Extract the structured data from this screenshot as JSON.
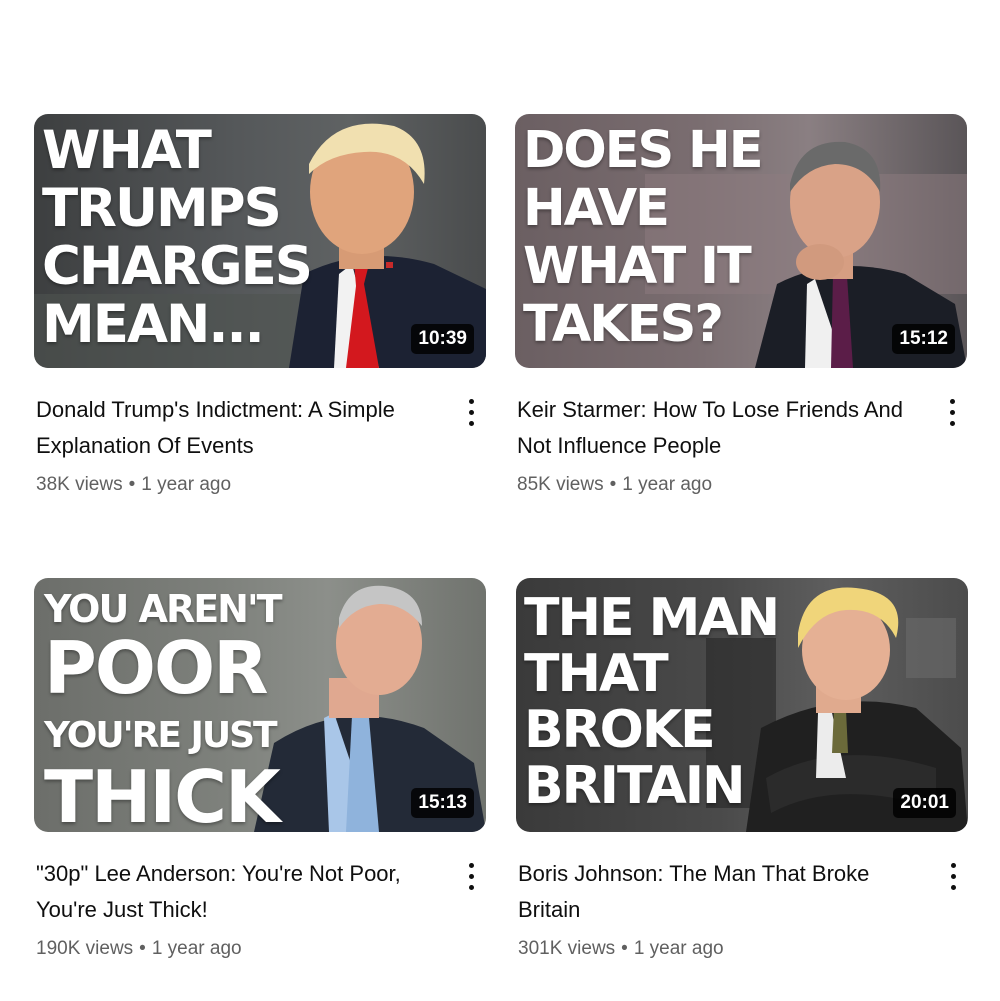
{
  "videos": [
    {
      "thumbnail_text": [
        "WHAT",
        "TRUMPS",
        "CHARGES",
        "MEAN..."
      ],
      "duration": "10:39",
      "title": "Donald Trump's Indictment: A Simple Explanation Of Events",
      "views": "38K views",
      "age": "1 year ago"
    },
    {
      "thumbnail_text": [
        "DOES HE",
        "HAVE",
        "WHAT IT",
        "TAKES?"
      ],
      "duration": "15:12",
      "title": "Keir Starmer: How To Lose Friends And Not Influence People",
      "views": "85K views",
      "age": "1 year ago"
    },
    {
      "thumbnail_text": [
        "YOU AREN'T",
        "POOR",
        "YOU'RE JUST",
        "THICK"
      ],
      "duration": "15:13",
      "title": "\"30p\" Lee Anderson: You're Not Poor, You're Just Thick!",
      "views": "190K views",
      "age": "1 year ago"
    },
    {
      "thumbnail_text": [
        "THE MAN",
        "THAT",
        "BROKE",
        "BRITAIN"
      ],
      "duration": "20:01",
      "title": "Boris Johnson: The Man That Broke Britain",
      "views": "301K views",
      "age": "1 year ago"
    }
  ],
  "separator": "•",
  "icons": {
    "menu": "more-vert-icon"
  },
  "colors": {
    "title": "#0f0f0f",
    "meta": "#606060",
    "duration_bg": "#000000"
  }
}
